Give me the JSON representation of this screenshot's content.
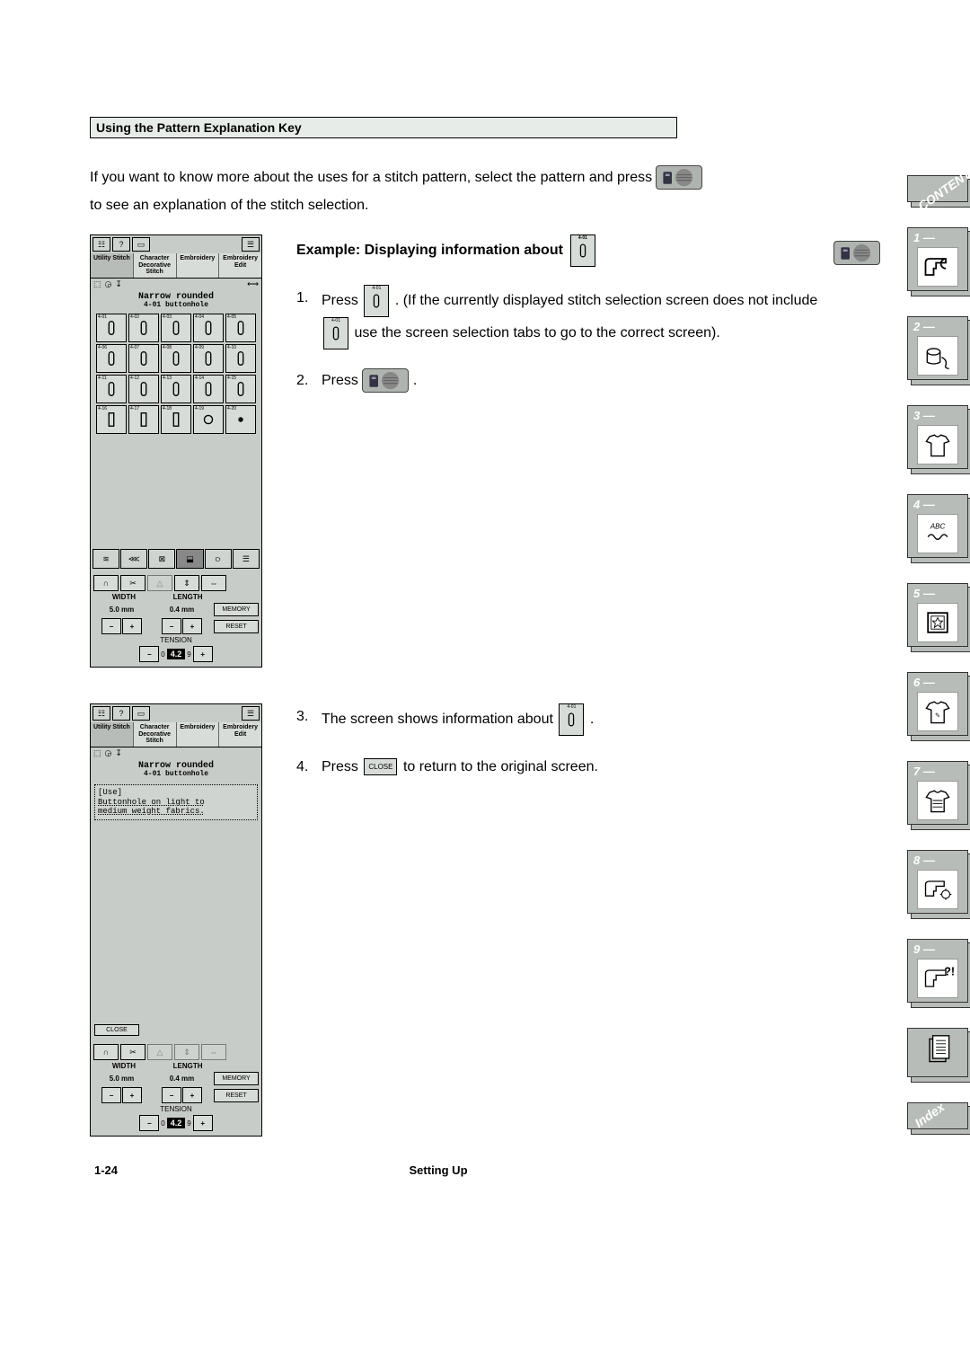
{
  "section_title": "Using the Pattern Explanation Key",
  "intro_line1": "If you want to know more about the uses for a stitch pattern, select the pattern and press",
  "intro_line2": "to see an explanation of the stitch selection.",
  "example_heading": "Example:  Displaying information about",
  "stitch_code": "4-01",
  "tabs": [
    "Utility\nStitch",
    "Character\nDecorative\nStitch",
    "Embroidery",
    "Embroidery\nEdit"
  ],
  "lcd": {
    "stitch_name_top": "Narrow rounded",
    "stitch_name_sub": "4-01  buttonhole",
    "grid_codes": [
      "4-01",
      "4-02",
      "4-03",
      "4-04",
      "4-05",
      "4-06",
      "4-07",
      "4-08",
      "4-09",
      "4-10",
      "4-11",
      "4-12",
      "4-13",
      "4-14",
      "4-15",
      "4-16",
      "4-17",
      "4-18",
      "4-19",
      "4-20"
    ],
    "width_label": "WIDTH",
    "length_label": "LENGTH",
    "width_val": "5.0 mm",
    "length_val": "0.4 mm",
    "memory": "MEMORY",
    "reset": "RESET",
    "tension_label": "TENSION",
    "tension_low": "0",
    "tension_mid": "4.2",
    "tension_high": "9",
    "use_header": "[Use]",
    "use_text1": "Buttonhole on light to",
    "use_text2": "medium weight fabrics.",
    "close": "CLOSE"
  },
  "steps": {
    "s1a": "Press",
    "s1b": ". (If the currently displayed stitch selection screen does not include",
    "s1c": "use the screen selection tabs to go to the correct screen).",
    "s2a": "Press",
    "s2_end": ".",
    "s3a": "The screen shows information about",
    "s3_end": ".",
    "s4a": "Press",
    "s4b": "to return to the original screen."
  },
  "footer": {
    "page": "1-24",
    "chapter": "Setting Up"
  },
  "side": {
    "contents": "CONTENTS",
    "chapters": [
      "1 —",
      "2 —",
      "3 —",
      "4 —",
      "5 —",
      "6 —",
      "7 —",
      "8 —",
      "9 —"
    ],
    "index": "Index"
  }
}
